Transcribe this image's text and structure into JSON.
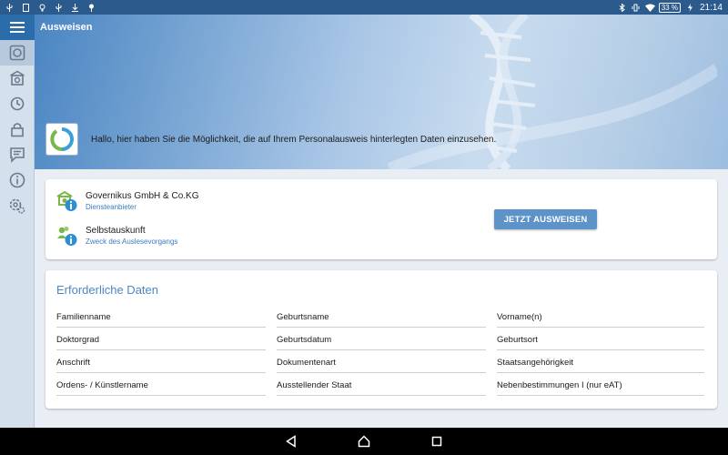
{
  "status_bar": {
    "left_icons": [
      "usb-icon",
      "sim-icon",
      "lightbulb-icon",
      "usb-icon",
      "download-icon",
      "pin-icon"
    ],
    "battery": "33 %",
    "time": "21:14"
  },
  "header": {
    "title": "Ausweisen",
    "intro": "Hallo, hier haben Sie die Möglichkeit, die auf Ihrem Personalausweis hinterlegten Daten einzusehen."
  },
  "provider_card": {
    "provider": {
      "name": "Governikus GmbH & Co.KG",
      "caption": "Diensteanbieter"
    },
    "purpose": {
      "name": "Selbstauskunft",
      "caption": "Zweck des Auslesevorgangs"
    },
    "button": "JETZT AUSWEISEN"
  },
  "required_data": {
    "title": "Erforderliche Daten",
    "fields": [
      "Familienname",
      "Geburtsname",
      "Vorname(n)",
      "Doktorgrad",
      "Geburtsdatum",
      "Geburtsort",
      "Anschrift",
      "Dokumentenart",
      "Staatsangehörigkeit",
      "Ordens- / Künstlername",
      "Ausstellender Staat",
      "Nebenbestimmungen I (nur eAT)"
    ]
  },
  "colors": {
    "status_bar": "#2b5a8c",
    "accent": "#4c87c3",
    "button": "#5e93c9",
    "sidebar": "#d4e0ec"
  }
}
